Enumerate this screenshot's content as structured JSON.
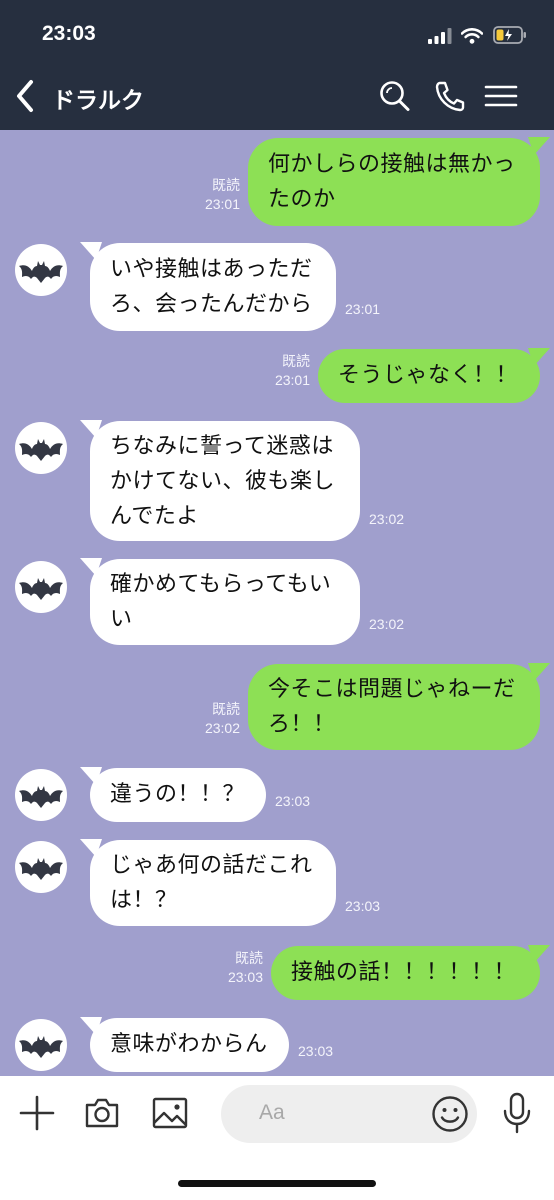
{
  "status": {
    "time": "23:03"
  },
  "header": {
    "title": "ドラルク"
  },
  "icons": {
    "back": "chevron-left-icon",
    "search": "search-icon",
    "call": "phone-icon",
    "menu": "hamburger-menu-icon",
    "plus": "plus-icon",
    "camera": "camera-icon",
    "image": "image-icon",
    "emoji": "smiley-icon",
    "mic": "microphone-icon",
    "avatar": "bat-avatar-icon"
  },
  "colors": {
    "header_bg": "#262f3f",
    "chat_bg": "#a09fcd",
    "sent_bubble": "#8de055",
    "received_bubble": "#ffffff"
  },
  "messages": [
    {
      "side": "me",
      "lines": [
        "何かしらの接触は無かっ",
        "たのか"
      ],
      "read": "既読",
      "time": "23:01"
    },
    {
      "side": "them",
      "lines": [
        "いや接触はあっただ",
        "ろ、会ったんだから"
      ],
      "time": "23:01"
    },
    {
      "side": "me",
      "lines": [
        "そうじゃなく！！"
      ],
      "read": "既読",
      "time": "23:01"
    },
    {
      "side": "them",
      "lines": [
        "ちなみに誓って迷惑は",
        "かけてない、彼も楽し",
        "んでたよ"
      ],
      "time": "23:02"
    },
    {
      "side": "them",
      "lines": [
        "確かめてもらってもい",
        "い"
      ],
      "time": "23:02"
    },
    {
      "side": "me",
      "lines": [
        "今そこは問題じゃねーだ",
        "ろ！！"
      ],
      "read": "既読",
      "time": "23:02"
    },
    {
      "side": "them",
      "lines": [
        "違うの！！？"
      ],
      "time": "23:03"
    },
    {
      "side": "them",
      "lines": [
        "じゃあ何の話だこれ",
        "は！？"
      ],
      "time": "23:03"
    },
    {
      "side": "me",
      "lines": [
        "接触の話！！！！！！"
      ],
      "read": "既読",
      "time": "23:03"
    },
    {
      "side": "them",
      "lines": [
        "意味がわからん"
      ],
      "time": "23:03"
    }
  ],
  "input": {
    "placeholder": "Aa"
  }
}
